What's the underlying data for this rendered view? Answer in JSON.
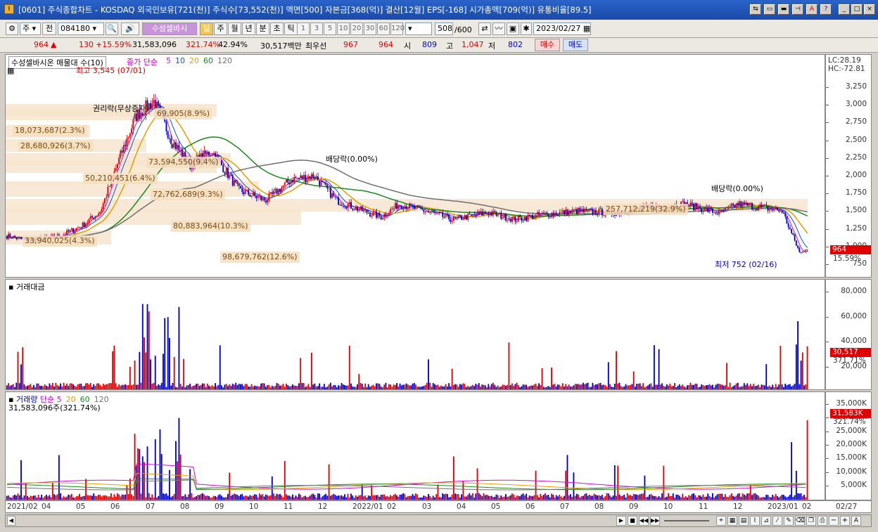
{
  "window": {
    "title": "[0601] 주식종합차트 - KOSDAQ 외국인보유[721(천)] 주식수[73,552(천)] 액면[500] 자본금[368(억)] 결산[12월] EPS[-168] 시가총액[709(억)] 유통비율[89.5]"
  },
  "toolbar": {
    "market": "주",
    "prefix": "전",
    "code": "084180",
    "name": "수성셀바시",
    "period_tabs": [
      "일",
      "주",
      "월",
      "년",
      "분",
      "초",
      "틱"
    ],
    "period_selected": "일",
    "intervals": [
      "1",
      "3",
      "5",
      "10",
      "20",
      "30",
      "60",
      "120"
    ],
    "count": "508",
    "count_max": "/600",
    "date": "2023/02/27"
  },
  "quote": {
    "price": "964",
    "change": "130",
    "change_pct": "+15.59%",
    "volume": "31,583,096",
    "volume_pct": "321.74%",
    "ratio": "42.94%",
    "amount": "30,517백만",
    "best_ask_label": "최우선",
    "best_ask": "967",
    "best_bid": "964",
    "open_label": "시",
    "open": "809",
    "high_label": "고",
    "high": "1,047",
    "low_label": "저",
    "low": "802",
    "buy": "매수",
    "sell": "매도"
  },
  "price_pane": {
    "title": "수성셀바시온 매물대 수(10)",
    "ma_title": "종가 단순",
    "ma_periods": [
      "5",
      "10",
      "20",
      "60",
      "120"
    ],
    "lc": "LC:28.19",
    "hc": "HC:-72.81",
    "y_ticks": [
      "3,250",
      "3,000",
      "2,750",
      "2,500",
      "2,250",
      "2,000",
      "1,750",
      "1,500",
      "1,250",
      "1,000",
      "750"
    ],
    "current_price": "964",
    "current_pct": "15.59%",
    "annotations": {
      "max": "최고 3,545 (07/01)",
      "min": "최저 752 (02/16)",
      "rights": "권리락(무상증자)",
      "div1": "배당락(0.00%)",
      "div2": "배당락(0.00%)"
    },
    "volume_profile": [
      "18,073,687(2.3%)",
      "28,680,926(3.7%)",
      "50,210,451(6.4%)",
      "72,762,689(9.3%)",
      "80,883,964(10.3%)",
      "98,679,762(12.6%)",
      "73,594,550(9.4%)",
      "69,905(8.9%)",
      "257,712,219(32.9%)",
      "33,940,025(4.3%)"
    ]
  },
  "amount_pane": {
    "title": "거래대금",
    "y_ticks": [
      "80,000",
      "60,000",
      "40,000",
      "20,000"
    ],
    "current": "30,517",
    "current_pct": "371.71%"
  },
  "volume_pane": {
    "title": "거래량",
    "ma_title": "단순",
    "ma_periods": [
      "5",
      "20",
      "60",
      "120"
    ],
    "current_label": "31,583,096주(321.74%)",
    "y_ticks": [
      "35,000K",
      "30,000K",
      "25,000K",
      "20,000K",
      "15,000K",
      "10,000K",
      "5,000K"
    ],
    "current": "31,583K",
    "current_pct": "321.74%"
  },
  "date_axis": [
    "2021/02",
    "04",
    "05",
    "06",
    "07",
    "08",
    "09",
    "10",
    "11",
    "12",
    "2022/01",
    "02",
    "03",
    "04",
    "05",
    "06",
    "07",
    "08",
    "09",
    "10",
    "11",
    "12",
    "2023/01",
    "02"
  ],
  "date_axis_right": "02/27",
  "colors": {
    "up": "#e00000",
    "down": "#0000d0",
    "ma5": "#d010d0",
    "ma10": "#1e4fbf",
    "ma20": "#e0a000",
    "ma60": "#1a8a1a",
    "ma120": "#707070"
  }
}
